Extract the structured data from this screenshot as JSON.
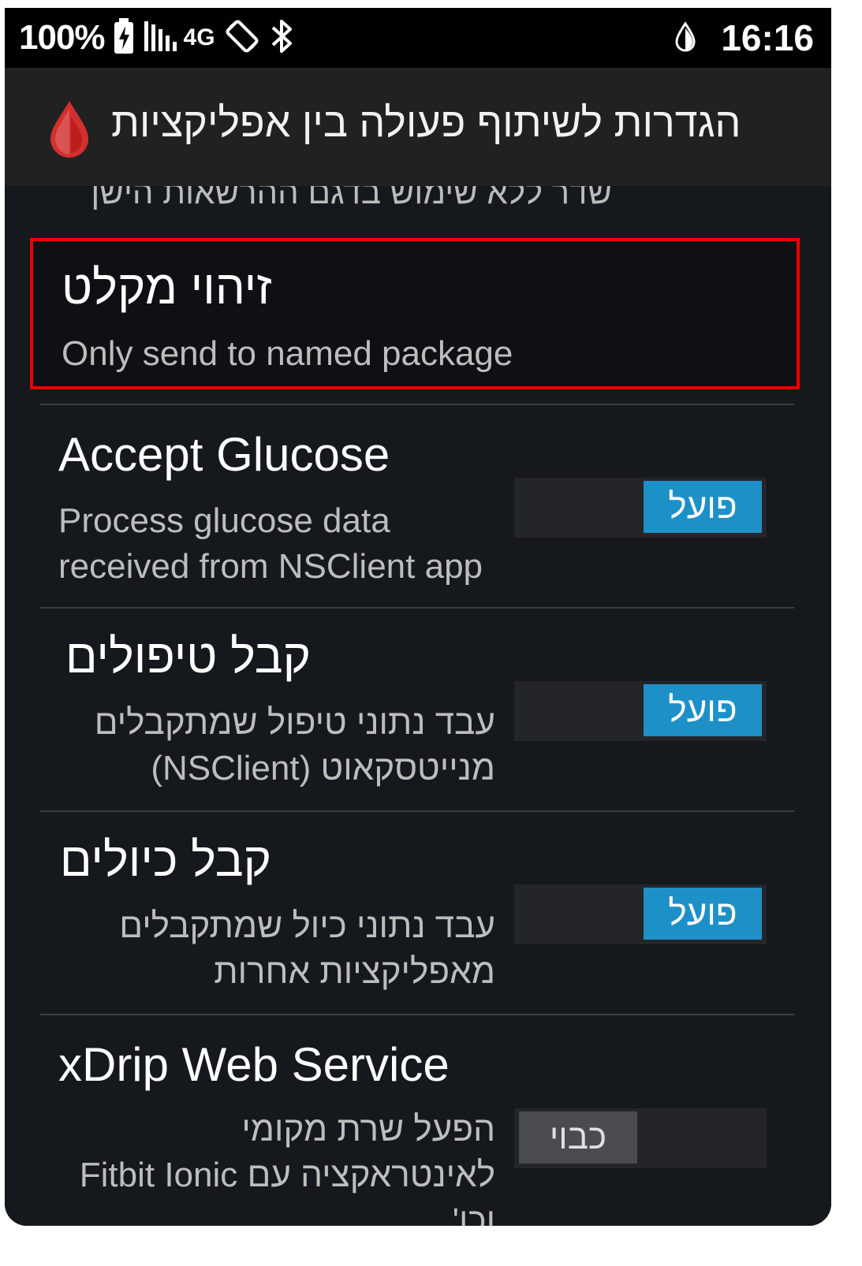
{
  "status_bar": {
    "battery_percent": "100%",
    "network_type": "4G",
    "time": "16:16"
  },
  "app_bar": {
    "title": "הגדרות לשיתוף פעולה בין אפליקציות",
    "logo_icon": "blood-drop-icon",
    "accent_color": "#d32f2f"
  },
  "preferences": {
    "partial_summary": "שדר ללא שימוש בדגם ההרשאות הישן",
    "items": [
      {
        "title": "זיהוי מקלט",
        "summary_lines": [
          "Only send to named package"
        ],
        "highlighted": true
      },
      {
        "title": "Accept Glucose",
        "summary_lines": [
          "Process glucose data",
          "received from NSClient app"
        ],
        "toggle_label": "פועל",
        "toggle_on": true
      },
      {
        "title": "קבל טיפולים",
        "summary_lines": [
          "עבד נתוני טיפול שמתקבלים",
          "מנייטסקאוט (NSClient)"
        ],
        "toggle_label": "פועל",
        "toggle_on": true
      },
      {
        "title": "קבל כיולים",
        "summary_lines": [
          "עבד נתוני כיול שמתקבלים",
          "מאפליקציות אחרות"
        ],
        "toggle_label": "פועל",
        "toggle_on": true
      },
      {
        "title": "xDrip Web Service",
        "summary_lines": [
          "הפעל שרת מקומי",
          "לאינטראקציה עם Fitbit Ionic",
          "וכו'"
        ],
        "toggle_label": "כבוי",
        "toggle_on": false
      }
    ]
  },
  "colors": {
    "toggle_on": "#1e90c8",
    "toggle_off": "#4a4c50",
    "highlight_border": "#ee0000"
  }
}
